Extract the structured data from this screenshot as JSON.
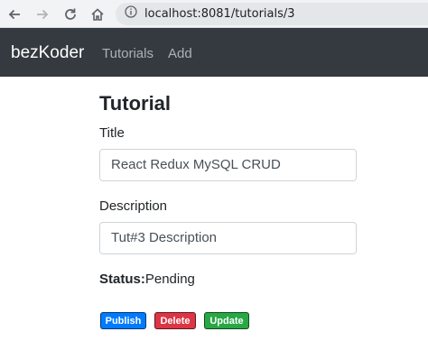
{
  "browser": {
    "url": "localhost:8081/tutorials/3",
    "back_icon": "back-arrow-icon",
    "forward_icon": "forward-arrow-icon",
    "reload_icon": "reload-icon",
    "home_icon": "home-icon",
    "info_icon": "site-info-icon"
  },
  "navbar": {
    "brand": "bezKoder",
    "links": [
      "Tutorials",
      "Add"
    ]
  },
  "form": {
    "heading": "Tutorial",
    "title_label": "Title",
    "title_value": "React Redux MySQL CRUD",
    "description_label": "Description",
    "description_value": "Tut#3 Description",
    "status_label": "Status:",
    "status_value": "Pending"
  },
  "actions": {
    "publish_label": "Publish",
    "delete_label": "Delete",
    "update_label": "Update"
  },
  "colors": {
    "navbar_bg": "#343a40",
    "publish": "#007bff",
    "delete": "#dc3545",
    "update": "#28a745"
  }
}
